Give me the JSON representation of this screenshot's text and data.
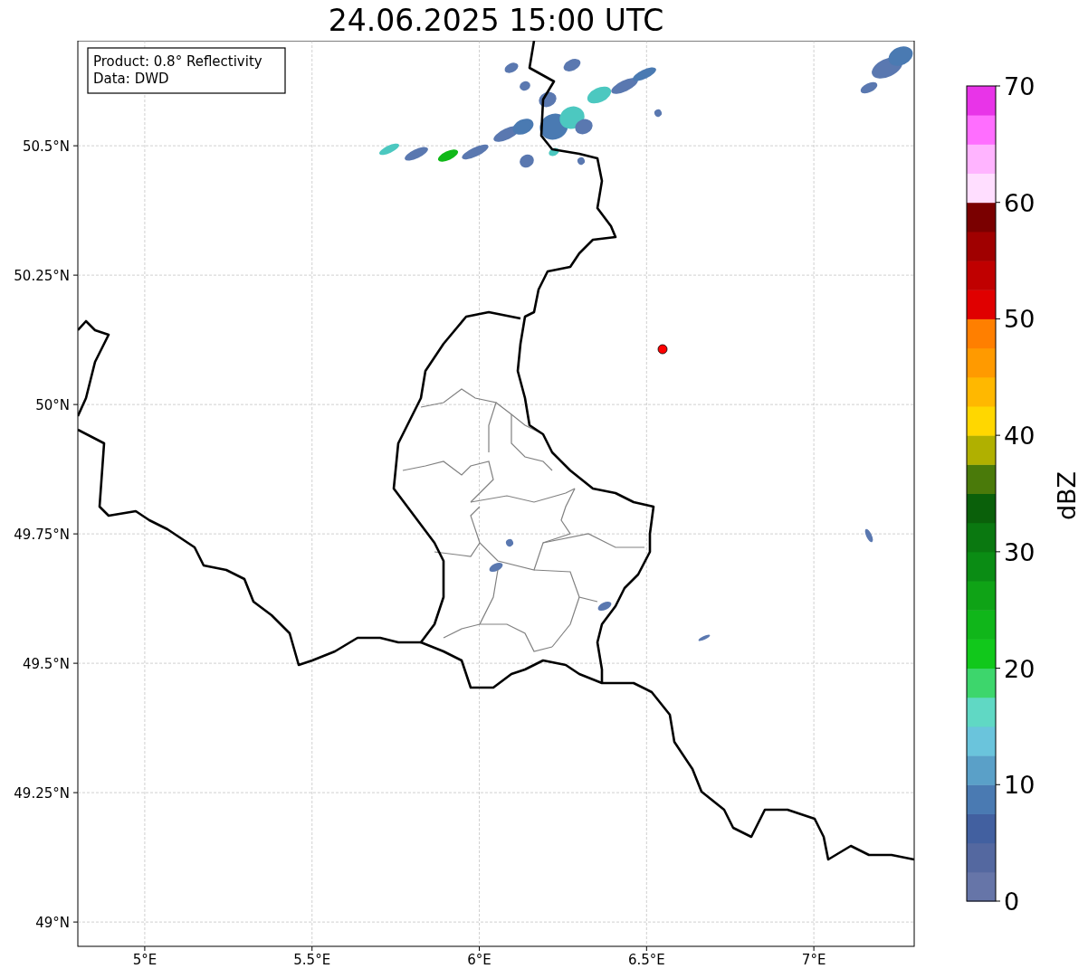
{
  "title": "24.06.2025 15:00 UTC",
  "map": {
    "info_box": [
      "Product: 0.8° Reflectivity",
      "Data: DWD"
    ],
    "yticks": [
      "50.5°N",
      "50.25°N",
      "50°N",
      "49.75°N",
      "49.5°N",
      "49.25°N",
      "49°N"
    ],
    "xticks": [
      "5°E",
      "5.5°E",
      "6°E",
      "6.5°E",
      "7°E"
    ]
  },
  "colorbar": {
    "label": "dBZ",
    "ticks": [
      "70",
      "60",
      "50",
      "40",
      "30",
      "20",
      "10",
      "0"
    ],
    "segments": [
      {
        "color": "#6675a8"
      },
      {
        "color": "#5468a0"
      },
      {
        "color": "#4260a0"
      },
      {
        "color": "#4a7ab2"
      },
      {
        "color": "#5aa0c8"
      },
      {
        "color": "#6ac4dc"
      },
      {
        "color": "#60d8c4"
      },
      {
        "color": "#3dd66c"
      },
      {
        "color": "#11c81b"
      },
      {
        "color": "#10b61a"
      },
      {
        "color": "#0fa316"
      },
      {
        "color": "#0a8c14"
      },
      {
        "color": "#0a7810"
      },
      {
        "color": "#0a600a"
      },
      {
        "color": "#4a7a0a"
      },
      {
        "color": "#b0b000"
      },
      {
        "color": "#ffd700"
      },
      {
        "color": "#ffb800"
      },
      {
        "color": "#ff9a00"
      },
      {
        "color": "#ff7f00"
      },
      {
        "color": "#e00000"
      },
      {
        "color": "#c00000"
      },
      {
        "color": "#a00000"
      },
      {
        "color": "#7a0000"
      },
      {
        "color": "#ffdeff"
      },
      {
        "color": "#ffb4ff"
      },
      {
        "color": "#ff6eff"
      },
      {
        "color": "#e834e8"
      }
    ]
  }
}
